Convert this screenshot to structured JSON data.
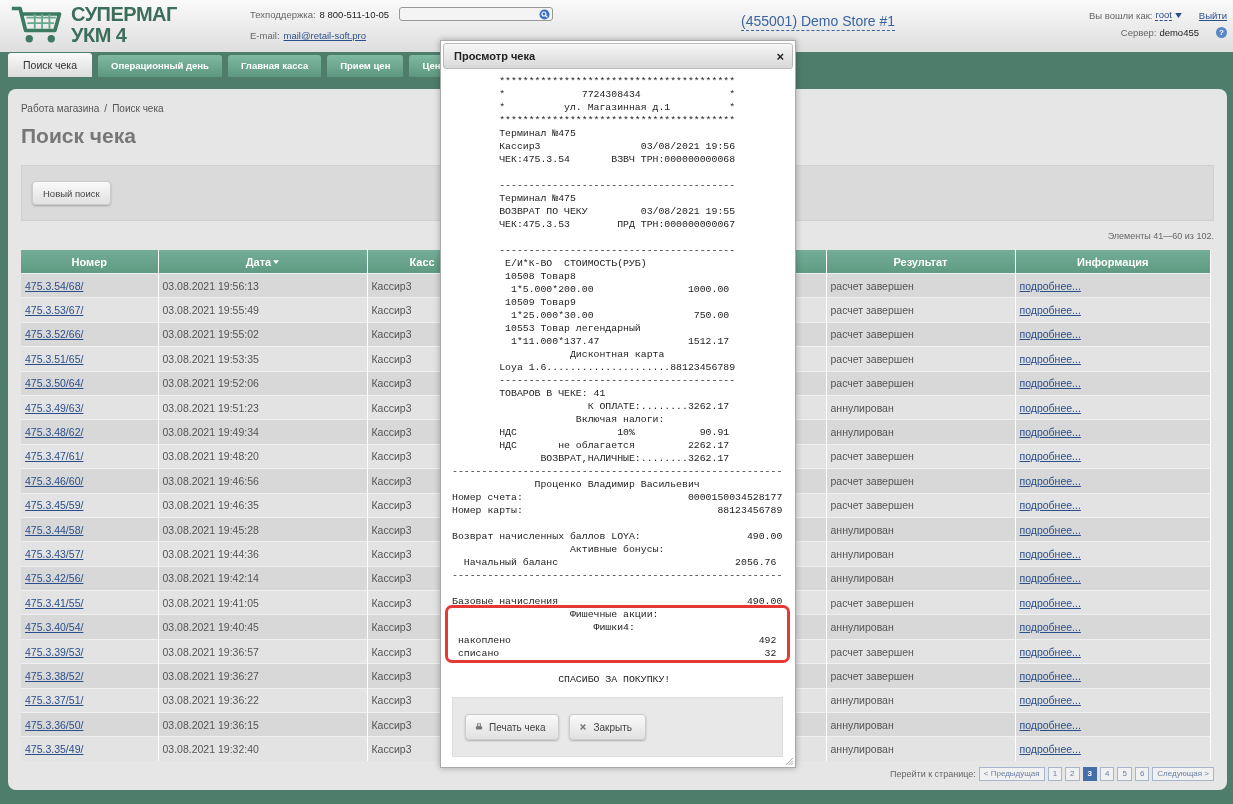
{
  "header": {
    "logo_top": "СУПЕРМАГ",
    "logo_bottom": "УКМ 4",
    "support_label": "Техподдержка:",
    "support_phone": "8 800-511-10-05",
    "email_label": "E-mail:",
    "email": "mail@retail-soft.pro",
    "store": "(455001) Demo Store #1",
    "login_label": "Вы вошли как:",
    "user": "root",
    "logout": "Выйти",
    "server_label": "Сервер:",
    "server": "demo455",
    "help": "?"
  },
  "tabs": [
    {
      "label": "Поиск чека",
      "selected": true
    },
    {
      "label": "Операционный день",
      "selected": false
    },
    {
      "label": "Главная касса",
      "selected": false
    },
    {
      "label": "Прием цен",
      "selected": false
    },
    {
      "label": "Цен",
      "selected": false
    }
  ],
  "breadcrumb": [
    "Работа магазина",
    "Поиск чека"
  ],
  "breadcrumb_separator": "/",
  "page_title": "Поиск чека",
  "new_search": "Новый поиск",
  "items_info": "Элементы 41—60 из 102.",
  "table": {
    "columns": [
      {
        "label": "Номер",
        "sorted": false
      },
      {
        "label": "Дата",
        "sorted": true
      },
      {
        "label": "Касс",
        "sorted": false
      },
      {
        "label": "Результат",
        "sorted": false
      },
      {
        "label": "Информация",
        "sorted": false
      }
    ],
    "rows": [
      {
        "number": "475.3.54/68/",
        "date": "03.08.2021 19:56:13",
        "cashier": "Кассир3",
        "result": "расчет завершен",
        "info": "подробнее..."
      },
      {
        "number": "475.3.53/67/",
        "date": "03.08.2021 19:55:49",
        "cashier": "Кассир3",
        "result": "расчет завершен",
        "info": "подробнее..."
      },
      {
        "number": "475.3.52/66/",
        "date": "03.08.2021 19:55:02",
        "cashier": "Кассир3",
        "result": "расчет завершен",
        "info": "подробнее..."
      },
      {
        "number": "475.3.51/65/",
        "date": "03.08.2021 19:53:35",
        "cashier": "Кассир3",
        "result": "расчет завершен",
        "info": "подробнее..."
      },
      {
        "number": "475.3.50/64/",
        "date": "03.08.2021 19:52:06",
        "cashier": "Кассир3",
        "result": "расчет завершен",
        "info": "подробнее..."
      },
      {
        "number": "475.3.49/63/",
        "date": "03.08.2021 19:51:23",
        "cashier": "Кассир3",
        "result": "аннулирован",
        "info": "подробнее..."
      },
      {
        "number": "475.3.48/62/",
        "date": "03.08.2021 19:49:34",
        "cashier": "Кассир3",
        "result": "аннулирован",
        "info": "подробнее..."
      },
      {
        "number": "475.3.47/61/",
        "date": "03.08.2021 19:48:20",
        "cashier": "Кассир3",
        "result": "расчет завершен",
        "info": "подробнее..."
      },
      {
        "number": "475.3.46/60/",
        "date": "03.08.2021 19:46:56",
        "cashier": "Кассир3",
        "result": "расчет завершен",
        "info": "подробнее..."
      },
      {
        "number": "475.3.45/59/",
        "date": "03.08.2021 19:46:35",
        "cashier": "Кассир3",
        "result": "расчет завершен",
        "info": "подробнее..."
      },
      {
        "number": "475.3.44/58/",
        "date": "03.08.2021 19:45:28",
        "cashier": "Кассир3",
        "result": "аннулирован",
        "info": "подробнее..."
      },
      {
        "number": "475.3.43/57/",
        "date": "03.08.2021 19:44:36",
        "cashier": "Кассир3",
        "result": "аннулирован",
        "info": "подробнее..."
      },
      {
        "number": "475.3.42/56/",
        "date": "03.08.2021 19:42:14",
        "cashier": "Кассир3",
        "result": "аннулирован",
        "info": "подробнее..."
      },
      {
        "number": "475.3.41/55/",
        "date": "03.08.2021 19:41:05",
        "cashier": "Кассир3",
        "result": "расчет завершен",
        "info": "подробнее..."
      },
      {
        "number": "475.3.40/54/",
        "date": "03.08.2021 19:40:45",
        "cashier": "Кассир3",
        "result": "аннулирован",
        "info": "подробнее..."
      },
      {
        "number": "475.3.39/53/",
        "date": "03.08.2021 19:36:57",
        "cashier": "Кассир3",
        "result": "расчет завершен",
        "info": "подробнее..."
      },
      {
        "number": "475.3.38/52/",
        "date": "03.08.2021 19:36:27",
        "cashier": "Кассир3",
        "result": "расчет завершен",
        "info": "подробнее..."
      },
      {
        "number": "475.3.37/51/",
        "date": "03.08.2021 19:36:22",
        "cashier": "Кассир3",
        "result": "аннулирован",
        "info": "подробнее..."
      },
      {
        "number": "475.3.36/50/",
        "date": "03.08.2021 19:36:15",
        "cashier": "Кассир3",
        "result": "аннулирован",
        "info": "подробнее..."
      },
      {
        "number": "475.3.35/49/",
        "date": "03.08.2021 19:32:40",
        "cashier": "Кассир3",
        "result": "аннулирован",
        "info": "подробнее..."
      }
    ]
  },
  "pagination": {
    "label": "Перейти к странице:",
    "prev": "< Предыдущая",
    "next": "Следующая >",
    "pages": [
      {
        "label": "1",
        "selected": false
      },
      {
        "label": "2",
        "selected": false
      },
      {
        "label": "3",
        "selected": true
      },
      {
        "label": "4",
        "selected": false
      },
      {
        "label": "5",
        "selected": false
      },
      {
        "label": "6",
        "selected": false
      }
    ]
  },
  "dialog": {
    "title": "Просмотр чека",
    "close": "×",
    "print_button": "Печать чека",
    "close_button": "Закрыть",
    "receipt": [
      {
        "highlighted": false,
        "space_after": true,
        "lines": [
          "        ****************************************",
          "        *             7724308434               *",
          "        *          ул. Магазинная д.1          *",
          "        ****************************************",
          "        Терминал №475",
          "        Кассир3                 03/08/2021 19:56",
          "        ЧЕК:475.3.54       ВЗВЧ ТРН:000000000068"
        ]
      },
      {
        "highlighted": false,
        "space_after": true,
        "lines": [
          "        ----------------------------------------",
          "        Терминал №475",
          "        ВОЗВРАТ ПО ЧЕКУ         03/08/2021 19:55",
          "        ЧЕК:475.3.53        ПРД ТРН:000000000067"
        ]
      },
      {
        "highlighted": false,
        "space_after": true,
        "lines": [
          "        ----------------------------------------",
          "         Е/И*К-ВО  СТОИМОСТЬ(РУБ)",
          "         10508 Товар8",
          "          1*5.000*200.00                1000.00",
          "         10509 Товар9",
          "          1*25.000*30.00                 750.00",
          "         10553 Товар легендарный",
          "          1*11.000*137.47               1512.17",
          "                    Дисконтная карта",
          "        Loya 1.6.....................88123456789",
          "        ----------------------------------------",
          "        ТОВАРОВ В ЧЕКЕ: 41",
          "                       К ОПЛАТЕ:........3262.17",
          "                     Включая налоги:",
          "        НДС                 10%           90.91",
          "        НДС       не облагается         2262.17",
          "               ВОЗВРАТ,НАЛИЧНЫЕ:........3262.17",
          "--------------------------------------------------------",
          "              Проценко Владимир Васильевич",
          "Номер счета:                            0000150034528177",
          "Номер карты:                                 88123456789"
        ]
      },
      {
        "highlighted": false,
        "space_after": true,
        "lines": [
          "Возврат начисленных баллов LOYA:                  490.00",
          "                    Активные бонусы:",
          "  Начальный баланс                              2056.76",
          "--------------------------------------------------------"
        ]
      },
      {
        "highlighted": false,
        "space_after": false,
        "lines": [
          "Базовые начисления                                490.00"
        ]
      },
      {
        "highlighted": true,
        "space_after": true,
        "lines": [
          "                    Фишечные акции:",
          "                        Фишки4:",
          " накоплено                                          492",
          " списано                                             32"
        ]
      },
      {
        "highlighted": false,
        "space_after": false,
        "lines": [
          "                  СПАСИБО ЗА ПОКУПКУ!"
        ]
      }
    ]
  }
}
